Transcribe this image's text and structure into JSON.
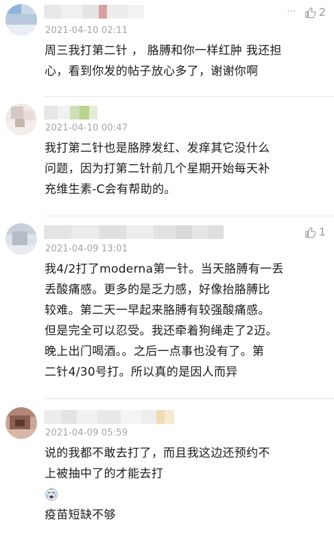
{
  "comments": [
    {
      "timestamp": "2021-04-10 02:11",
      "text": "周三我打第二针 ， 胳膊和你一样红肿 我还担心，看到你发的帖子放心多了，谢谢你啊",
      "lines": [
        "周三我打第二针 ， 胳膊和你一样红肿 我还担",
        "心，看到你发的帖子放心多了，谢谢你啊"
      ],
      "likes": "2"
    },
    {
      "timestamp": "2021-04-10 00:47",
      "lines": [
        "我打第二针也是胳脖发红、发痒其它没什么",
        "问题，因为打第二针前几个星期开始每天补",
        "充维生素-C会有帮助的。"
      ]
    },
    {
      "timestamp": "2021-04-09 13:01",
      "lines": [
        "我4/2打了moderna第一针。当天胳膊有一丢",
        "丢酸痛感。更多的是乏力感，好像抬胳膊比",
        "较难。第二天一早起来胳膊有较强酸痛感。",
        "但是完全可以忍受。我还牵着狗绳走了2迈。",
        "晚上出门喝酒。。之后一点事也没有了。第",
        "二针4/30号打。所以真的是因人而异"
      ],
      "likes": "1"
    },
    {
      "timestamp": "2021-04-09 05:59",
      "lines": [
        "说的我都不敢去打了，而且我这边还预约不",
        "上被抽中了的才能去打"
      ],
      "emoji": "crying-face-emoji",
      "trailing": "疫苗短缺不够"
    }
  ],
  "colors": {
    "text": "#1b1b1b",
    "timestamp": "#a3a3a3",
    "divider": "#e6e6e6",
    "like": "#9b9b9b"
  }
}
